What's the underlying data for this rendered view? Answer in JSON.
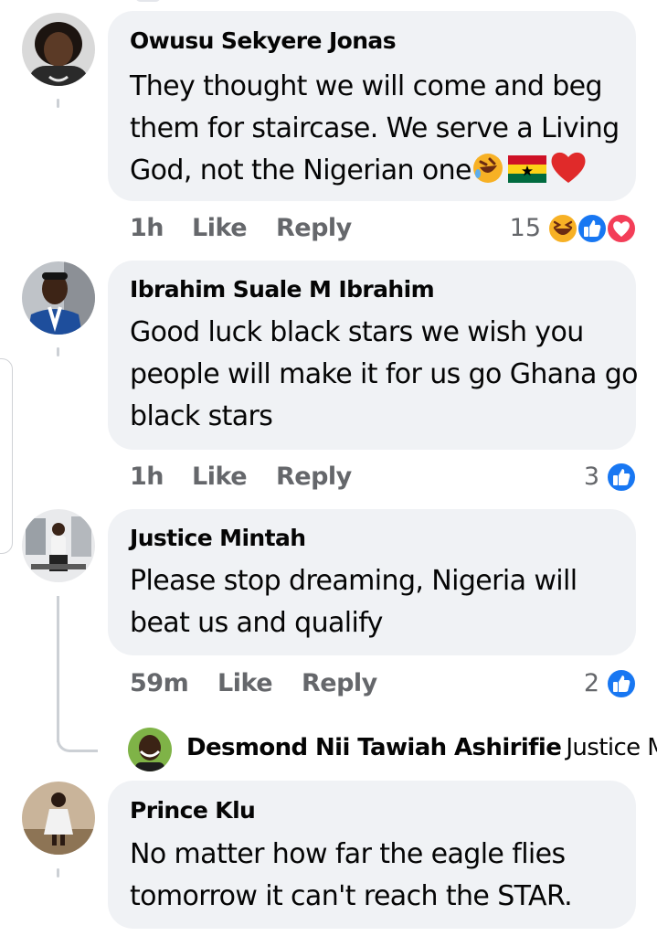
{
  "comments": [
    {
      "name": "Owusu Sekyere Jonas",
      "lines": [
        "They thought we will come and beg",
        "them for staircase. We serve a Living",
        "God, not the Nigerian one"
      ],
      "time": "1h",
      "like": "Like",
      "reply": "Reply",
      "reactions": "15",
      "reaction_icons": [
        "laughing-emoji-icon",
        "like-reaction-icon",
        "love-reaction-icon"
      ],
      "inline_emoji": [
        "rolling-laughing-emoji-icon",
        "ghana-flag-icon",
        "red-heart-icon"
      ]
    },
    {
      "name": "Ibrahim Suale M Ibrahim",
      "lines": [
        "Good luck black stars we wish you",
        "people will make it for us go Ghana go",
        "black stars"
      ],
      "time": "1h",
      "like": "Like",
      "reply": "Reply",
      "reactions": "3",
      "reaction_icons": [
        "like-reaction-icon"
      ]
    },
    {
      "name": "Justice Mintah",
      "lines": [
        "Please stop dreaming, Nigeria will",
        "beat us and qualify"
      ],
      "time": "59m",
      "like": "Like",
      "reply": "Reply",
      "reactions": "2",
      "reaction_icons": [
        "like-reaction-icon"
      ]
    },
    {
      "name": "Prince Klu",
      "lines": [
        "No matter how far the eagle flies",
        "tomorrow it can't reach the STAR."
      ]
    }
  ],
  "reply_preview": {
    "name": "Desmond Nii Tawiah Ashirifie",
    "snippet": "Justice M..."
  },
  "colors": {
    "bubble": "#f0f2f5",
    "meta_text": "#65676b",
    "like_blue": "#1877f2",
    "love_red": "#f33e58",
    "haha_yellow": "#f7b125"
  }
}
